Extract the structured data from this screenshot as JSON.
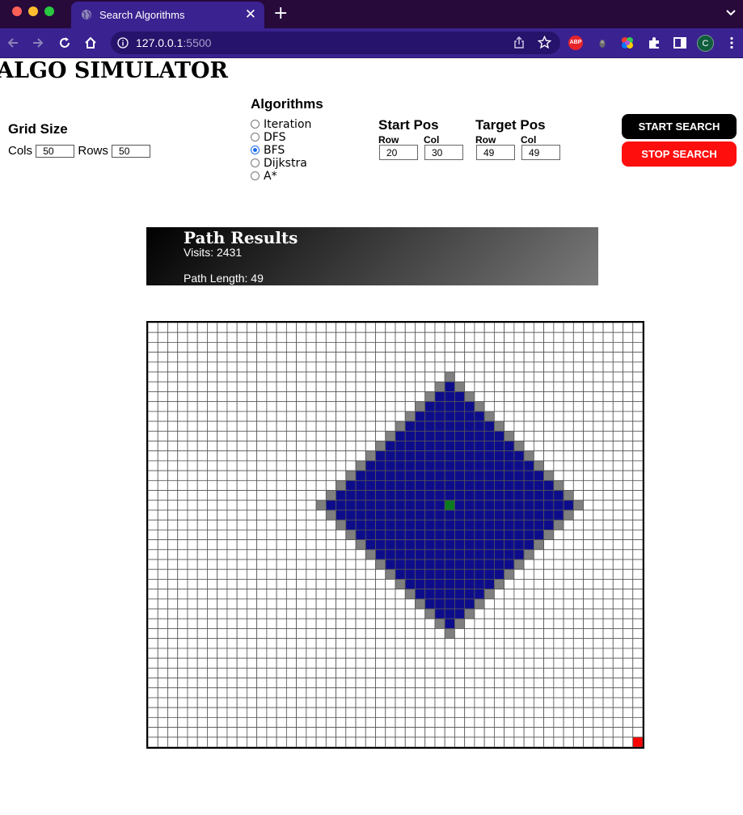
{
  "browser": {
    "tab_title": "Search Algorithms",
    "new_tab_label": "+",
    "url_host": "127.0.0.1",
    "url_port": ":5500",
    "extensions": [
      "abp-icon",
      "extension-dot-icon",
      "color-wheel-icon",
      "puzzle-icon",
      "sidebar-icon"
    ],
    "abp_label": "ABP",
    "avatar_initial": "C",
    "colors": {
      "tabbar": "#27093a",
      "toolbar": "#3a2290"
    }
  },
  "page": {
    "title": "ALGO SIMULATOR"
  },
  "grid_size": {
    "heading": "Grid Size",
    "cols_label": "Cols",
    "cols_value": "50",
    "rows_label": "Rows",
    "rows_value": "50"
  },
  "algorithms": {
    "heading": "Algorithms",
    "options": [
      {
        "label": "Iteration",
        "selected": false
      },
      {
        "label": "DFS",
        "selected": false
      },
      {
        "label": "BFS",
        "selected": true
      },
      {
        "label": "Dijkstra",
        "selected": false
      },
      {
        "label": "A*",
        "selected": false
      }
    ]
  },
  "start_pos": {
    "heading": "Start Pos",
    "row_label": "Row",
    "row_value": "20",
    "col_label": "Col",
    "col_value": "30"
  },
  "target_pos": {
    "heading": "Target Pos",
    "row_label": "Row",
    "row_value": "49",
    "col_label": "Col",
    "col_value": "49"
  },
  "buttons": {
    "start": "START SEARCH",
    "stop": "STOP SEARCH"
  },
  "results": {
    "heading": "Path Results",
    "visits": "Visits: 2431",
    "path_length": "Path Length: 49"
  },
  "grid": {
    "cols": 50,
    "rows": 43,
    "start_cell": {
      "row": 18,
      "col": 30
    },
    "target_cell": {
      "row": 42,
      "col": 49
    },
    "visited_radius": 12,
    "frontier_radius": 13,
    "colors": {
      "empty": "#ffffff",
      "line": "#555555",
      "visited": "#0d0d8c",
      "frontier": "#7f7f7f",
      "start": "#0c7a1e",
      "target": "#ff0000"
    }
  }
}
